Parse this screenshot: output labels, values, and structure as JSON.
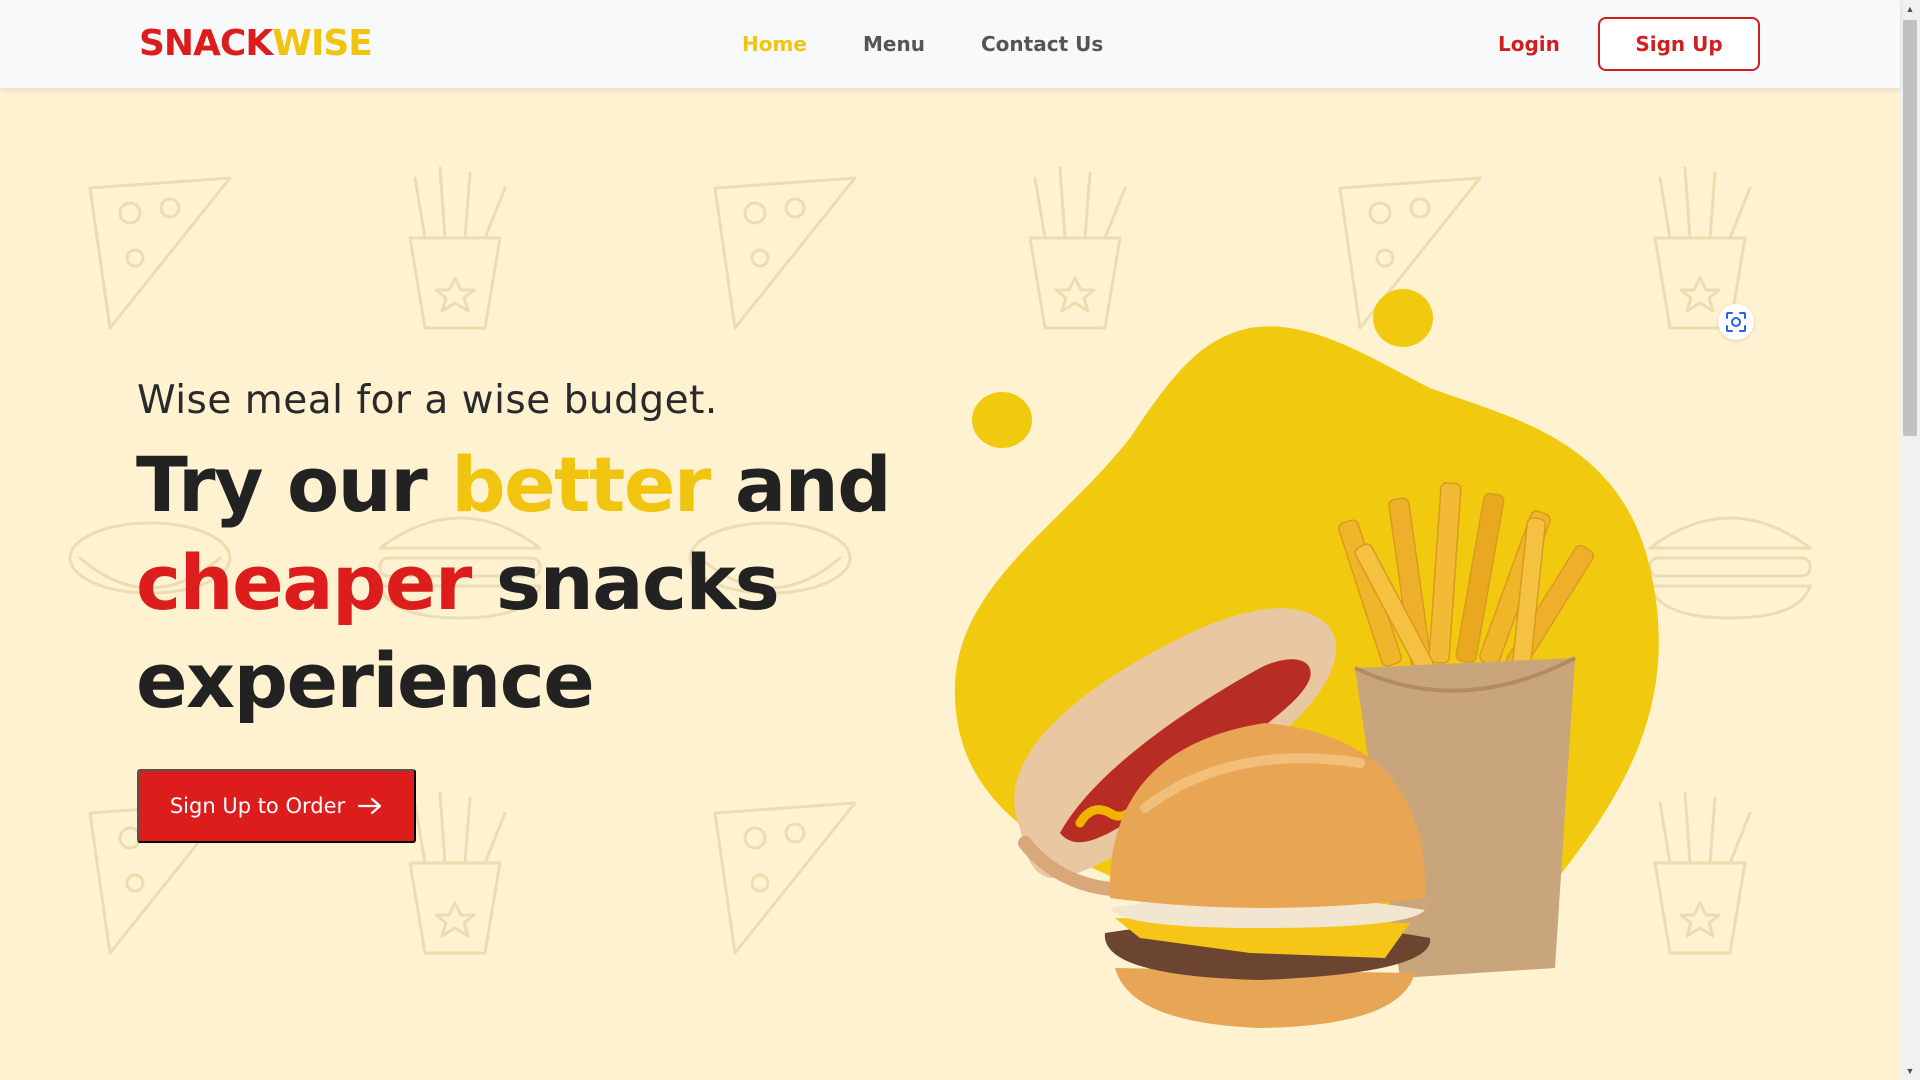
{
  "brand": {
    "part1": "SNACK",
    "part2": "WISE"
  },
  "nav": {
    "home": "Home",
    "menu": "Menu",
    "contact": "Contact Us"
  },
  "auth": {
    "login": "Login",
    "signup": "Sign Up"
  },
  "hero": {
    "tagline": "Wise meal for a wise budget.",
    "headline": {
      "w1": "Try our ",
      "w2": "better",
      "w3": " and",
      "w4": "cheaper",
      "w5": " snacks",
      "w6": "experience"
    },
    "cta": "Sign Up to Order"
  },
  "colors": {
    "red": "#dd1c1c",
    "yellow": "#f1c40f",
    "background": "#fff2d1",
    "header": "#f8f9fb"
  },
  "icons": {
    "cta_arrow": "arrow-right-icon",
    "lens": "visual-search-icon"
  }
}
